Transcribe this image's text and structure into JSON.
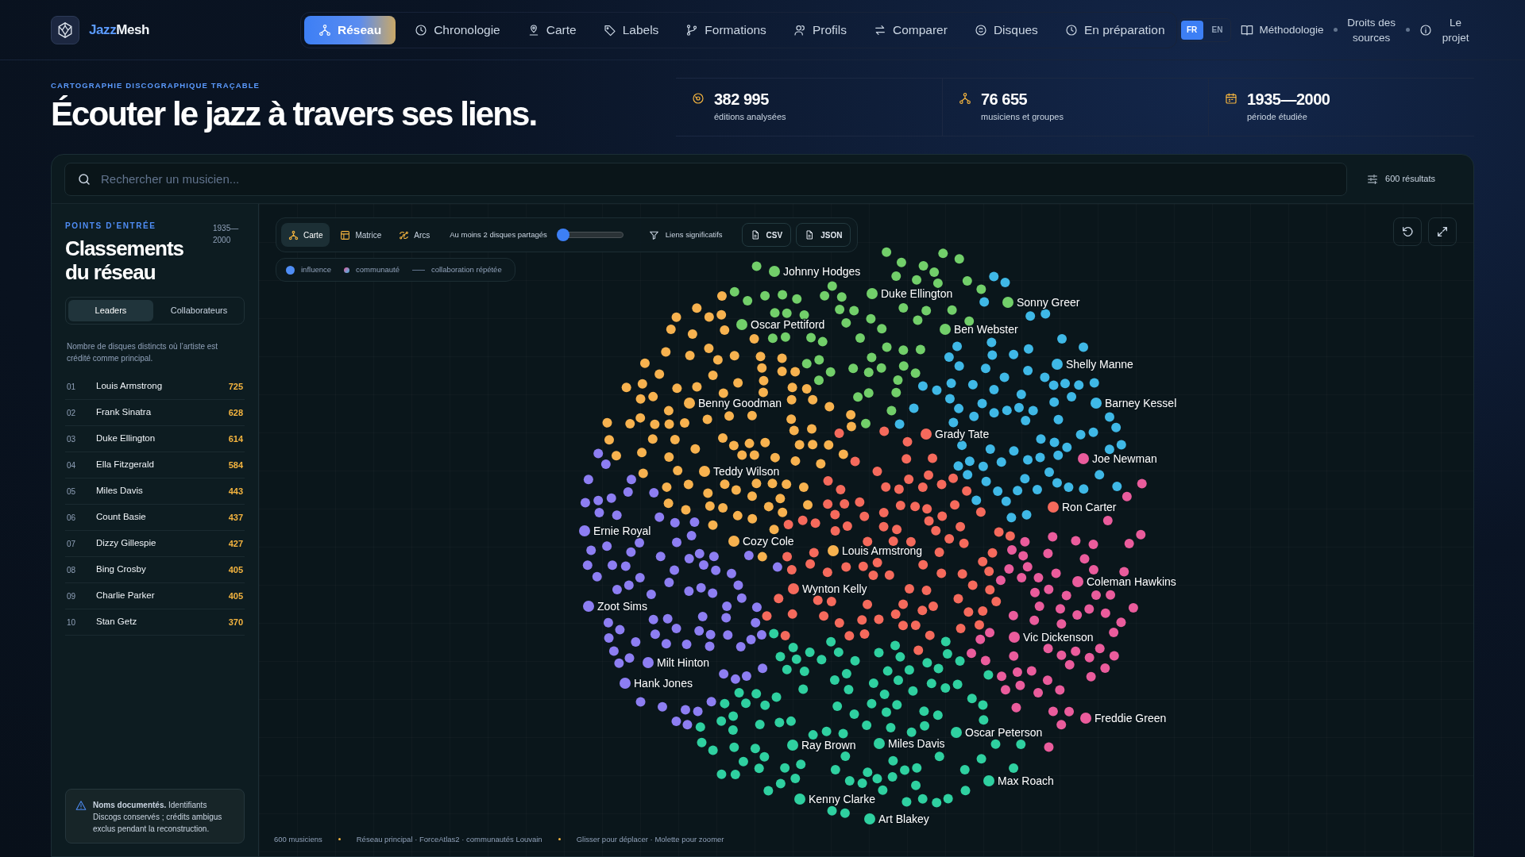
{
  "brand": {
    "accent": "Jazz",
    "rest": "Mesh"
  },
  "nav": [
    {
      "label": "Réseau",
      "selected": true
    },
    {
      "label": "Chronologie",
      "selected": false
    },
    {
      "label": "Carte",
      "selected": false
    },
    {
      "label": "Labels",
      "selected": false
    },
    {
      "label": "Formations",
      "selected": false
    },
    {
      "label": "Profils",
      "selected": false
    },
    {
      "label": "Comparer",
      "selected": false
    },
    {
      "label": "Disques",
      "selected": false
    },
    {
      "label": "En préparation",
      "selected": false
    }
  ],
  "languages": [
    {
      "label": "FR",
      "selected": true
    },
    {
      "label": "EN",
      "selected": false
    }
  ],
  "links": [
    "Méthodologie",
    "Droits des sources",
    "Le projet"
  ],
  "hero": {
    "eyebrow": "CARTOGRAPHIE DISCOGRAPHIQUE TRAÇABLE",
    "title": "Écouter le jazz à travers ses liens."
  },
  "stats": [
    {
      "value": "382 995",
      "label": "éditions analysées"
    },
    {
      "value": "76 655",
      "label": "musiciens et groupes"
    },
    {
      "value": "1935—2000",
      "label": "période étudiée"
    }
  ],
  "search": {
    "placeholder": "Rechercher un musicien...",
    "results": "600 résultats"
  },
  "rankings": {
    "eyebrow": "POINTS D’ENTRÉE",
    "period": "1935—2000",
    "title": "Classements du réseau",
    "tabs": [
      {
        "label": "Leaders",
        "selected": true
      },
      {
        "label": "Collaborateurs",
        "selected": false
      }
    ],
    "description": "Nombre de disques distincts où l’artiste est crédité comme principal.",
    "rows": [
      {
        "rank": "01",
        "name": "Louis Armstrong",
        "count": "725"
      },
      {
        "rank": "02",
        "name": "Frank Sinatra",
        "count": "628"
      },
      {
        "rank": "03",
        "name": "Duke Ellington",
        "count": "614"
      },
      {
        "rank": "04",
        "name": "Ella Fitzgerald",
        "count": "584"
      },
      {
        "rank": "05",
        "name": "Miles Davis",
        "count": "443"
      },
      {
        "rank": "06",
        "name": "Count Basie",
        "count": "437"
      },
      {
        "rank": "07",
        "name": "Dizzy Gillespie",
        "count": "427"
      },
      {
        "rank": "08",
        "name": "Bing Crosby",
        "count": "405"
      },
      {
        "rank": "09",
        "name": "Charlie Parker",
        "count": "405"
      },
      {
        "rank": "10",
        "name": "Stan Getz",
        "count": "370"
      }
    ]
  },
  "note": "**Noms documentés.** Identifiants Discogs conservés ; crédits ambigus exclus pendant la reconstruction.",
  "graph": {
    "views": [
      {
        "label": "Carte",
        "selected": true
      },
      {
        "label": "Matrice",
        "selected": false
      },
      {
        "label": "Arcs",
        "selected": false
      }
    ],
    "slider": {
      "label": "Au moins 2 disques partagés",
      "level": 0
    },
    "filter": "Liens significatifs",
    "exports": [
      "CSV",
      "JSON"
    ],
    "legend": [
      "influence",
      "communauté",
      "collaboration répétée"
    ],
    "nodes": [
      {
        "name": "Johnny Hodges",
        "color": "#72cf6a"
      },
      {
        "name": "Duke Ellington",
        "color": "#72cf6a"
      },
      {
        "name": "Sonny Greer",
        "color": "#72cf6a"
      },
      {
        "name": "Oscar Pettiford",
        "color": "#72cf6a"
      },
      {
        "name": "Ben Webster",
        "color": "#72cf6a"
      },
      {
        "name": "Shelly Manne",
        "color": "#3fb8e6"
      },
      {
        "name": "Benny Goodman",
        "color": "#f7b24f"
      },
      {
        "name": "Barney Kessel",
        "color": "#3fb8e6"
      },
      {
        "name": "Grady Tate",
        "color": "#f56a5c"
      },
      {
        "name": "Joe Newman",
        "color": "#ea5c9c"
      },
      {
        "name": "Teddy Wilson",
        "color": "#f7b24f"
      },
      {
        "name": "Ron Carter",
        "color": "#f56a5c"
      },
      {
        "name": "Ernie Royal",
        "color": "#8d7ef2"
      },
      {
        "name": "Cozy Cole",
        "color": "#f7b24f"
      },
      {
        "name": "Louis Armstrong",
        "color": "#f7b24f"
      },
      {
        "name": "Coleman Hawkins",
        "color": "#ea5c9c"
      },
      {
        "name": "Wynton Kelly",
        "color": "#f56a5c"
      },
      {
        "name": "Zoot Sims",
        "color": "#8d7ef2"
      },
      {
        "name": "Vic Dickenson",
        "color": "#ea5c9c"
      },
      {
        "name": "Milt Hinton",
        "color": "#8d7ef2"
      },
      {
        "name": "Hank Jones",
        "color": "#8d7ef2"
      },
      {
        "name": "Freddie Green",
        "color": "#ea5c9c"
      },
      {
        "name": "Oscar Peterson",
        "color": "#2fd0a0"
      },
      {
        "name": "Ray Brown",
        "color": "#2fd0a0"
      },
      {
        "name": "Miles Davis",
        "color": "#2fd0a0"
      },
      {
        "name": "Max Roach",
        "color": "#2fd0a0"
      },
      {
        "name": "Kenny Clarke",
        "color": "#2fd0a0"
      },
      {
        "name": "Art Blakey",
        "color": "#2fd0a0"
      }
    ],
    "footer": [
      "600 musiciens",
      "Réseau principal · ForceAtlas2 · communautés Louvain",
      "Glisser pour déplacer · Molette pour zoomer"
    ]
  }
}
